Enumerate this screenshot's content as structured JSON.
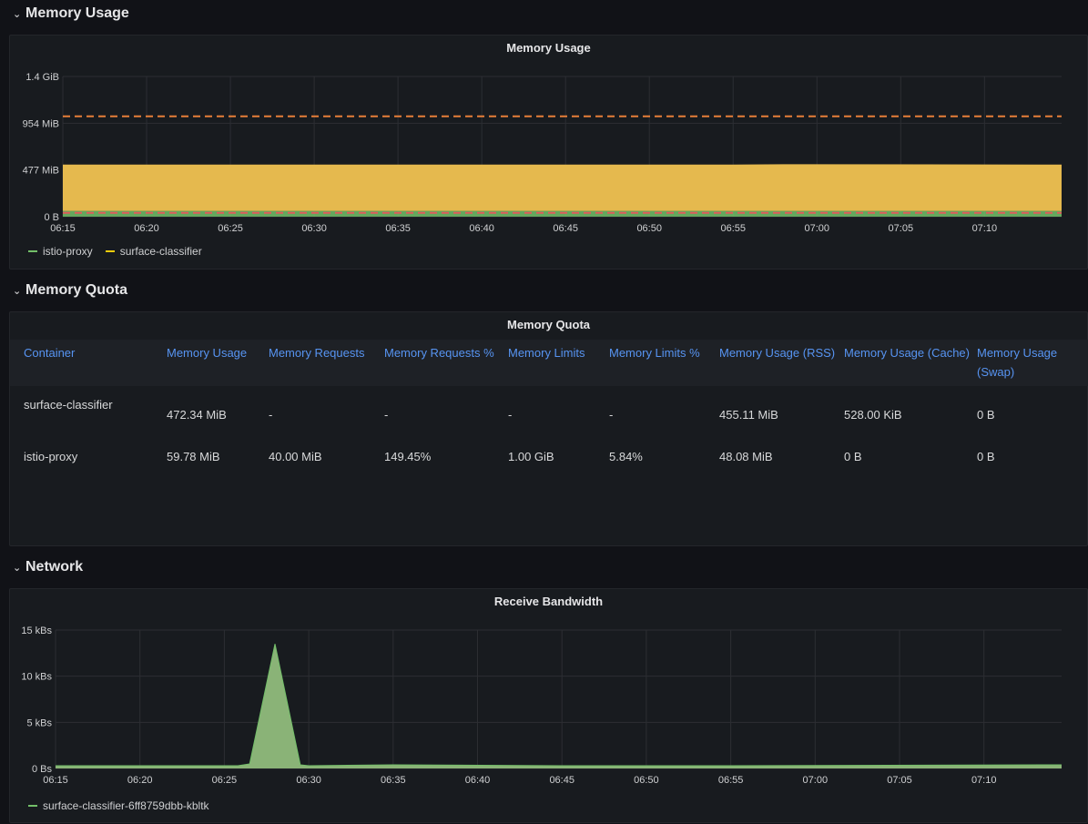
{
  "sections": {
    "memory_usage": {
      "label": "Memory Usage"
    },
    "memory_quota": {
      "label": "Memory Quota"
    },
    "network": {
      "label": "Network"
    }
  },
  "memory_usage_panel": {
    "title": "Memory Usage",
    "legend": [
      {
        "name": "istio-proxy",
        "color": "#73bf69"
      },
      {
        "name": "surface-classifier",
        "color": "#f2cc0c"
      }
    ]
  },
  "memory_quota_panel": {
    "title": "Memory Quota",
    "columns": [
      "Container",
      "Memory Usage",
      "Memory Requests",
      "Memory Requests %",
      "Memory Limits",
      "Memory Limits %",
      "Memory Usage (RSS)",
      "Memory Usage (Cache)",
      "Memory Usage (Swap)"
    ],
    "rows": [
      {
        "container": "surface-classifier",
        "usage": "472.34 MiB",
        "requests": "-",
        "requests_pct": "-",
        "limits": "-",
        "limits_pct": "-",
        "rss": "455.11 MiB",
        "cache": "528.00 KiB",
        "swap": "0 B"
      },
      {
        "container": "istio-proxy",
        "usage": "59.78 MiB",
        "requests": "40.00 MiB",
        "requests_pct": "149.45%",
        "limits": "1.00 GiB",
        "limits_pct": "5.84%",
        "rss": "48.08 MiB",
        "cache": "0 B",
        "swap": "0 B"
      }
    ]
  },
  "receive_bandwidth_panel": {
    "title": "Receive Bandwidth",
    "legend": [
      {
        "name": "surface-classifier-6ff8759dbb-kbltk",
        "color": "#73bf69"
      }
    ]
  },
  "chart_data": [
    {
      "type": "area",
      "title": "Memory Usage",
      "x_ticks": [
        "06:15",
        "06:20",
        "06:25",
        "06:30",
        "06:35",
        "06:40",
        "06:45",
        "06:50",
        "06:55",
        "07:00",
        "07:05",
        "07:10"
      ],
      "y_ticks": [
        "0 B",
        "477 MiB",
        "954 MiB",
        "1.4 GiB"
      ],
      "ylim_mib": [
        0,
        1431
      ],
      "x_range_minutes": [
        0,
        59.6
      ],
      "stacked": true,
      "series": [
        {
          "name": "istio-proxy",
          "color": "#73bf69",
          "x": [
            0,
            59.6
          ],
          "y": [
            59.78,
            59.78
          ]
        },
        {
          "name": "surface-classifier",
          "color": "#e5b94e",
          "x": [
            0,
            10,
            20,
            40,
            43,
            59.6
          ],
          "y": [
            472,
            472,
            472,
            472,
            476,
            472
          ]
        }
      ],
      "thresholds": [
        {
          "name": "limit",
          "value_mib": 1024,
          "color": "#e67e39",
          "style": "dashed"
        },
        {
          "name": "request",
          "value_mib": 40,
          "color": "#e05c5c",
          "style": "dashed"
        }
      ],
      "legend_position": "bottom-left",
      "grid": true
    },
    {
      "type": "area",
      "title": "Receive Bandwidth",
      "x_ticks": [
        "06:15",
        "06:20",
        "06:25",
        "06:30",
        "06:35",
        "06:40",
        "06:45",
        "06:50",
        "06:55",
        "07:00",
        "07:05",
        "07:10"
      ],
      "y_ticks": [
        "0 Bs",
        "5 kBs",
        "10 kBs",
        "15 kBs"
      ],
      "ylim": [
        0,
        15
      ],
      "x_range_minutes": [
        0,
        59.6
      ],
      "series": [
        {
          "name": "surface-classifier-6ff8759dbb-kbltk",
          "color": "#73bf69",
          "x": [
            0,
            10,
            10.8,
            11.5,
            13,
            14.5,
            15,
            20,
            30,
            40,
            59.6
          ],
          "y": [
            0.3,
            0.3,
            0.3,
            0.5,
            13.5,
            0.4,
            0.3,
            0.4,
            0.3,
            0.3,
            0.4
          ]
        }
      ],
      "legend_position": "bottom-left",
      "grid": true
    }
  ]
}
